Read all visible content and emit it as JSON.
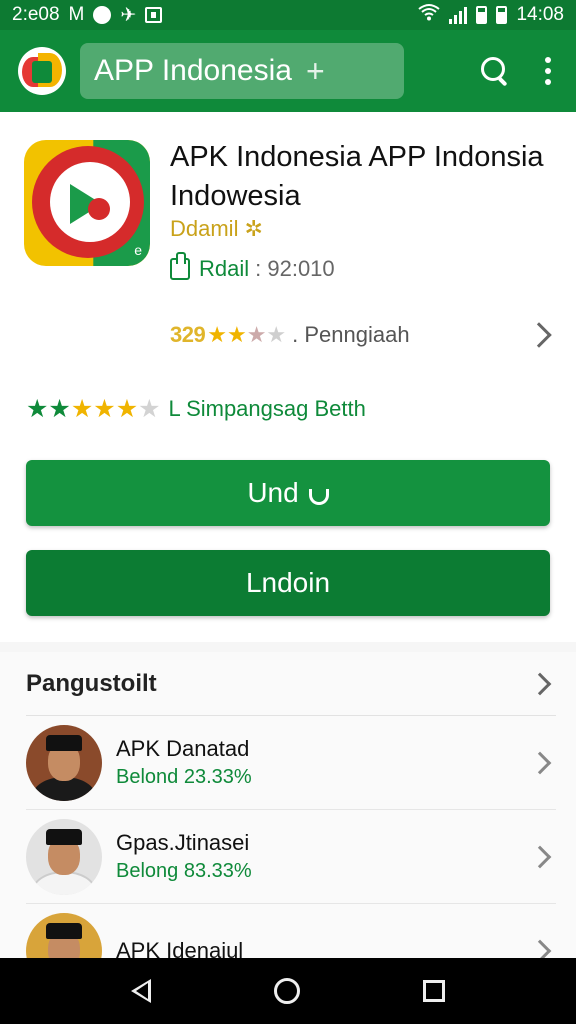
{
  "status_bar": {
    "left_text": "2:e08",
    "left_glyph": "M",
    "time": "14:08",
    "icons": [
      "clock-icon",
      "plane-icon",
      "square-icon",
      "wifi-icon",
      "signal-icon",
      "battery-icon"
    ]
  },
  "app_bar": {
    "search_text": "APP Indonesia",
    "plus": "+",
    "icons": [
      "app-logo",
      "search-icon",
      "more-vert-icon"
    ]
  },
  "app": {
    "title": "APK Indonesia APP Indonsia Indowesia",
    "developer": "Ddamil",
    "developer_symbol": "✲",
    "rank_label": "Rdail",
    "rank_value": ": 92:010",
    "rating_count": "329",
    "rating_stars": [
      1,
      1,
      0.5,
      0
    ],
    "rating_text": ". Penngiaah",
    "popularity_text": "L Simpangsag Betth",
    "install_label": "Und",
    "uninstall_label": "Lndoin"
  },
  "colors": {
    "primary": "#0f8a3a",
    "button": "#14923f",
    "star": "#f0b400",
    "developer": "#c9a21a"
  },
  "section": {
    "title": "Pangustoilt",
    "items": [
      {
        "name": "APK Danatad",
        "sub": "Belond 23.33%"
      },
      {
        "name": "Gpas.Jtinasei",
        "sub": "Belong 83.33%"
      },
      {
        "name": "APK Idenaiul",
        "sub": ""
      }
    ]
  },
  "nav": {
    "icons": [
      "back-icon",
      "home-icon",
      "recents-icon"
    ]
  }
}
